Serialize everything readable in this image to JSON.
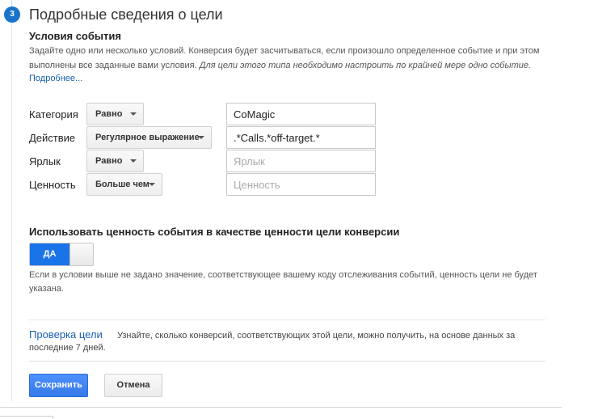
{
  "step": {
    "number": "3",
    "title": "Подробные сведения о цели"
  },
  "conditions": {
    "heading": "Условия события",
    "description_plain": "Задайте одно или несколько условий. Конверсия будет засчитываться, если произошло определенное событие и при этом выполнены все заданные вами условия. ",
    "description_italic": "Для цели этого типа необходимо настроить по крайней мере одно событие.",
    "more_link": "Подробнее..."
  },
  "rows": [
    {
      "label": "Категория",
      "operator": "Равно",
      "value": "CoMagic",
      "placeholder": ""
    },
    {
      "label": "Действие",
      "operator": "Регулярное выражение",
      "value": ".*Calls.*off-target.*",
      "placeholder": ""
    },
    {
      "label": "Ярлык",
      "operator": "Равно",
      "value": "",
      "placeholder": "Ярлык"
    },
    {
      "label": "Ценность",
      "operator": "Больше чем",
      "value": "",
      "placeholder": "Ценность"
    }
  ],
  "use_value": {
    "heading": "Использовать ценность события в качестве ценности цели конверсии",
    "toggle_label": "ДА",
    "note": "Если в условии выше не задано значение, соответствующее вашему коду отслеживания событий, ценность цели не будет указана."
  },
  "verify": {
    "title": "Проверка цели",
    "text": "Узнайте, сколько конверсий, соответствующих этой цели, можно получить, на основе данных за последние 7 дней."
  },
  "buttons": {
    "save": "Сохранить",
    "cancel": "Отмена"
  },
  "colors": {
    "accent": "#1a73e8",
    "link": "#1a5fb4"
  }
}
